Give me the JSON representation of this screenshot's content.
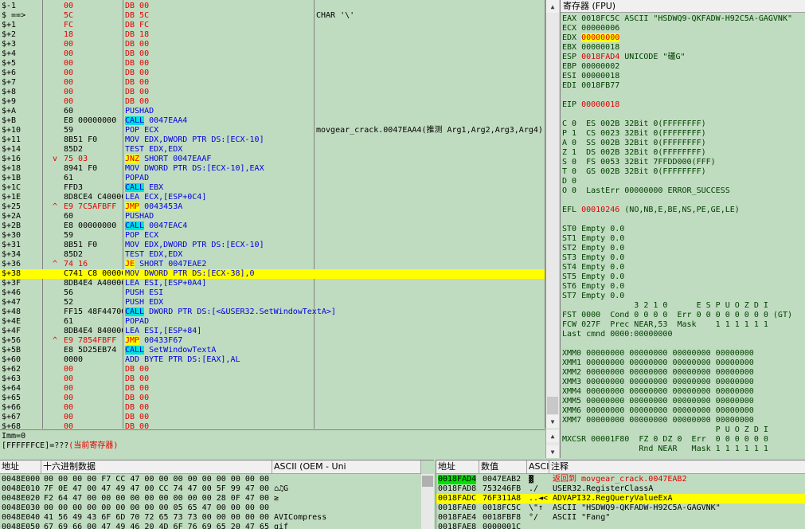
{
  "disasm": {
    "rows": [
      {
        "addr": "$-1",
        "hex": "00",
        "arrow": "",
        "instr": "DB 00",
        "instr_color": "red",
        "comment": ""
      },
      {
        "addr": "$ ==>",
        "hex": "5C",
        "arrow": "",
        "instr": "DB 5C",
        "instr_color": "red",
        "comment": "CHAR '\\'"
      },
      {
        "addr": "$+1",
        "hex": "FC",
        "arrow": "",
        "instr": "DB FC",
        "instr_color": "red",
        "comment": ""
      },
      {
        "addr": "$+2",
        "hex": "18",
        "arrow": "",
        "instr": "DB 18",
        "instr_color": "red",
        "comment": ""
      },
      {
        "addr": "$+3",
        "hex": "00",
        "arrow": "",
        "instr": "DB 00",
        "instr_color": "red",
        "comment": ""
      },
      {
        "addr": "$+4",
        "hex": "00",
        "arrow": "",
        "instr": "DB 00",
        "instr_color": "red",
        "comment": ""
      },
      {
        "addr": "$+5",
        "hex": "00",
        "arrow": "",
        "instr": "DB 00",
        "instr_color": "red",
        "comment": ""
      },
      {
        "addr": "$+6",
        "hex": "00",
        "arrow": "",
        "instr": "DB 00",
        "instr_color": "red",
        "comment": ""
      },
      {
        "addr": "$+7",
        "hex": "00",
        "arrow": "",
        "instr": "DB 00",
        "instr_color": "red",
        "comment": ""
      },
      {
        "addr": "$+8",
        "hex": "00",
        "arrow": "",
        "instr": "DB 00",
        "instr_color": "red",
        "comment": ""
      },
      {
        "addr": "$+9",
        "hex": "00",
        "arrow": "",
        "instr": "DB 00",
        "instr_color": "red",
        "comment": ""
      },
      {
        "addr": "$+A",
        "hex": "60",
        "arrow": "",
        "instr": "PUSHAD",
        "instr_color": "blue",
        "comment": ""
      },
      {
        "addr": "$+B",
        "hex": "E8 00000000",
        "arrow": "",
        "instr": "CALL 0047EAA4",
        "instr_color": "call",
        "comment": ""
      },
      {
        "addr": "$+10",
        "hex": "59",
        "arrow": "",
        "instr": "POP ECX",
        "instr_color": "blue",
        "comment": "movgear_crack.0047EAA4(推测 Arg1,Arg2,Arg3,Arg4)"
      },
      {
        "addr": "$+11",
        "hex": "8B51 F0",
        "arrow": "",
        "instr": "MOV EDX,DWORD PTR DS:[ECX-10]",
        "instr_color": "blue",
        "comment": ""
      },
      {
        "addr": "$+14",
        "hex": "85D2",
        "arrow": "",
        "instr": "TEST EDX,EDX",
        "instr_color": "blue",
        "comment": ""
      },
      {
        "addr": "$+16",
        "hex": "75 03",
        "arrow": "v",
        "instr": "JNZ SHORT 0047EAAF",
        "instr_color": "jmp",
        "comment": ""
      },
      {
        "addr": "$+18",
        "hex": "8941 F0",
        "arrow": "",
        "instr": "MOV DWORD PTR DS:[ECX-10],EAX",
        "instr_color": "blue",
        "comment": ""
      },
      {
        "addr": "$+1B",
        "hex": "61",
        "arrow": "",
        "instr": "POPAD",
        "instr_color": "blue",
        "comment": ""
      },
      {
        "addr": "$+1C",
        "hex": "FFD3",
        "arrow": "",
        "instr": "CALL EBX",
        "instr_color": "call",
        "comment": ""
      },
      {
        "addr": "$+1E",
        "hex": "8D8CE4 C40000",
        "arrow": "",
        "instr": "LEA ECX,[ESP+0C4]",
        "instr_color": "blue",
        "comment": ""
      },
      {
        "addr": "$+25",
        "hex": "E9 7C5AFBFF",
        "arrow": "^",
        "instr": "JMP 0043453A",
        "instr_color": "jmp",
        "comment": ""
      },
      {
        "addr": "$+2A",
        "hex": "60",
        "arrow": "",
        "instr": "PUSHAD",
        "instr_color": "blue",
        "comment": ""
      },
      {
        "addr": "$+2B",
        "hex": "E8 00000000",
        "arrow": "",
        "instr": "CALL 0047EAC4",
        "instr_color": "call",
        "comment": ""
      },
      {
        "addr": "$+30",
        "hex": "59",
        "arrow": "",
        "instr": "POP ECX",
        "instr_color": "blue",
        "comment": ""
      },
      {
        "addr": "$+31",
        "hex": "8B51 F0",
        "arrow": "",
        "instr": "MOV EDX,DWORD PTR DS:[ECX-10]",
        "instr_color": "blue",
        "comment": ""
      },
      {
        "addr": "$+34",
        "hex": "85D2",
        "arrow": "",
        "instr": "TEST EDX,EDX",
        "instr_color": "blue",
        "comment": ""
      },
      {
        "addr": "$+36",
        "hex": "74 16",
        "arrow": "^",
        "instr": "JE SHORT 0047EAE2",
        "instr_color": "jmp",
        "comment": ""
      },
      {
        "addr": "$+38",
        "hex": "C741 C8 00000000",
        "arrow": "",
        "instr": "MOV DWORD PTR DS:[ECX-38],0",
        "instr_color": "blue",
        "comment": "",
        "selected": true
      },
      {
        "addr": "$+3F",
        "hex": "8DB4E4 A40000",
        "arrow": "",
        "instr": "LEA ESI,[ESP+0A4]",
        "instr_color": "blue",
        "comment": ""
      },
      {
        "addr": "$+46",
        "hex": "56",
        "arrow": "",
        "instr": "PUSH ESI",
        "instr_color": "blue",
        "comment": ""
      },
      {
        "addr": "$+47",
        "hex": "52",
        "arrow": "",
        "instr": "PUSH EDX",
        "instr_color": "blue",
        "comment": ""
      },
      {
        "addr": "$+48",
        "hex": "FF15 48F44700",
        "arrow": "",
        "instr": "CALL DWORD PTR DS:[<&USER32.SetWindowTextA>]",
        "instr_color": "call",
        "comment": ""
      },
      {
        "addr": "$+4E",
        "hex": "61",
        "arrow": "",
        "instr": "POPAD",
        "instr_color": "blue",
        "comment": ""
      },
      {
        "addr": "$+4F",
        "hex": "8DB4E4 840000",
        "arrow": "",
        "instr": "LEA ESI,[ESP+84]",
        "instr_color": "blue",
        "comment": ""
      },
      {
        "addr": "$+56",
        "hex": "E9 7854FBFF",
        "arrow": "^",
        "instr": "JMP 00433F67",
        "instr_color": "jmp",
        "comment": ""
      },
      {
        "addr": "$+5B",
        "hex": "E8 5D25EB74",
        "arrow": "",
        "instr": "CALL SetWindowTextA",
        "instr_color": "call",
        "comment": ""
      },
      {
        "addr": "$+60",
        "hex": "0000",
        "arrow": "",
        "instr": "ADD BYTE PTR DS:[EAX],AL",
        "instr_color": "blue",
        "comment": ""
      },
      {
        "addr": "$+62",
        "hex": "00",
        "arrow": "",
        "instr": "DB 00",
        "instr_color": "red",
        "comment": ""
      },
      {
        "addr": "$+63",
        "hex": "00",
        "arrow": "",
        "instr": "DB 00",
        "instr_color": "red",
        "comment": ""
      },
      {
        "addr": "$+64",
        "hex": "00",
        "arrow": "",
        "instr": "DB 00",
        "instr_color": "red",
        "comment": ""
      },
      {
        "addr": "$+65",
        "hex": "00",
        "arrow": "",
        "instr": "DB 00",
        "instr_color": "red",
        "comment": ""
      },
      {
        "addr": "$+66",
        "hex": "00",
        "arrow": "",
        "instr": "DB 00",
        "instr_color": "red",
        "comment": ""
      },
      {
        "addr": "$+67",
        "hex": "00",
        "arrow": "",
        "instr": "DB 00",
        "instr_color": "red",
        "comment": ""
      },
      {
        "addr": "$+68",
        "hex": "00",
        "arrow": "",
        "instr": "DB 00",
        "instr_color": "red",
        "comment": ""
      }
    ]
  },
  "info": {
    "line1": "Imm=0",
    "line2_prefix": "[FFFFFFCE]=???",
    "line2_note": "(当前寄存器)"
  },
  "registers": {
    "title": "寄存器 (FPU)",
    "lines": [
      {
        "text": "EAX 0018FC5C ASCII \"HSDWQ9-QKFADW-H92C5A-GAGVNK\"",
        "red": false
      },
      {
        "text": "ECX 00000006",
        "red": false
      },
      {
        "text": "EDX 00000000",
        "red": true,
        "hl": "yellow"
      },
      {
        "text": "EBX 00000018",
        "red": false
      },
      {
        "text": "ESP 0018FAD4 UNICODE \"礚G\"",
        "red": true
      },
      {
        "text": "EBP 00000002",
        "red": false
      },
      {
        "text": "ESI 00000018",
        "red": false
      },
      {
        "text": "EDI 0018FB77",
        "red": false
      },
      {
        "text": "",
        "red": false
      },
      {
        "text": "EIP 00000018",
        "red": true
      },
      {
        "text": "",
        "red": false
      },
      {
        "text": "C 0  ES 002B 32Bit 0(FFFFFFFF)",
        "red": false
      },
      {
        "text": "P 1  CS 0023 32Bit 0(FFFFFFFF)",
        "red": false
      },
      {
        "text": "A 0  SS 002B 32Bit 0(FFFFFFFF)",
        "red": false
      },
      {
        "text": "Z 1  DS 002B 32Bit 0(FFFFFFFF)",
        "red": false
      },
      {
        "text": "S 0  FS 0053 32Bit 7FFDD000(FFF)",
        "red": false
      },
      {
        "text": "T 0  GS 002B 32Bit 0(FFFFFFFF)",
        "red": false
      },
      {
        "text": "D 0",
        "red": false
      },
      {
        "text": "O 0  LastErr 00000000 ERROR_SUCCESS",
        "red": false
      },
      {
        "text": "",
        "red": false
      },
      {
        "text": "EFL 00010246 (NO,NB,E,BE,NS,PE,GE,LE)",
        "red": true
      },
      {
        "text": "",
        "red": false
      },
      {
        "text": "ST0 Empty 0.0",
        "red": false
      },
      {
        "text": "ST1 Empty 0.0",
        "red": false
      },
      {
        "text": "ST2 Empty 0.0",
        "red": false
      },
      {
        "text": "ST3 Empty 0.0",
        "red": false
      },
      {
        "text": "ST4 Empty 0.0",
        "red": false
      },
      {
        "text": "ST5 Empty 0.0",
        "red": false
      },
      {
        "text": "ST6 Empty 0.0",
        "red": false
      },
      {
        "text": "ST7 Empty 0.0",
        "red": false
      },
      {
        "text": "               3 2 1 0      E S P U O Z D I",
        "red": false
      },
      {
        "text": "FST 0000  Cond 0 0 0 0  Err 0 0 0 0 0 0 0 0 (GT)",
        "red": false
      },
      {
        "text": "FCW 027F  Prec NEAR,53  Mask    1 1 1 1 1 1",
        "red": false
      },
      {
        "text": "Last cmnd 0000:00000000",
        "red": false
      },
      {
        "text": "",
        "red": false
      },
      {
        "text": "XMM0 00000000 00000000 00000000 00000000",
        "red": false
      },
      {
        "text": "XMM1 00000000 00000000 00000000 00000000",
        "red": false
      },
      {
        "text": "XMM2 00000000 00000000 00000000 00000000",
        "red": false
      },
      {
        "text": "XMM3 00000000 00000000 00000000 00000000",
        "red": false
      },
      {
        "text": "XMM4 00000000 00000000 00000000 00000000",
        "red": false
      },
      {
        "text": "XMM5 00000000 00000000 00000000 00000000",
        "red": false
      },
      {
        "text": "XMM6 00000000 00000000 00000000 00000000",
        "red": false
      },
      {
        "text": "XMM7 00000000 00000000 00000000 00000000",
        "red": false
      },
      {
        "text": "                                P U O Z D I",
        "red": false
      },
      {
        "text": "MXCSR 00001F80  FZ 0 DZ 0  Err  0 0 0 0 0 0",
        "red": false
      },
      {
        "text": "                Rnd NEAR   Mask 1 1 1 1 1 1",
        "red": false
      }
    ]
  },
  "dump": {
    "headers": {
      "addr": "地址",
      "hex": "十六进制数据",
      "ascii": "ASCII (OEM - Uni"
    },
    "rows": [
      {
        "addr": "0048E000",
        "hex": "00 00 00 00 F7 CC 47 00 00 00 00 00 00 00 00 00",
        "ascii": ""
      },
      {
        "addr": "0048E010",
        "hex": "7F 0E 47 00 47 49 47 00 CC 74 47 00 5F 99 47 00",
        "ascii": "⌂♫G"
      },
      {
        "addr": "0048E020",
        "hex": "F2 64 47 00 00 00 00 00 00 00 00 00 28 0F 47 00",
        "ascii": "≥"
      },
      {
        "addr": "0048E030",
        "hex": "00 00 00 00 00 00 00 00 00 05 65 47 00 00 00 00",
        "ascii": ""
      },
      {
        "addr": "0048E040",
        "hex": "41 56 49 43 6F 6D 70 72 65 73 73 00 00 00 00 00",
        "ascii": "AVICompress"
      },
      {
        "addr": "0048E050",
        "hex": "67 69 66 00 47 49 46 20 4D 6F 76 69 65 20 47 65",
        "ascii": "gif"
      }
    ]
  },
  "stack": {
    "headers": {
      "addr": "地址",
      "value": "数值",
      "ascii": "ASCI",
      "comment": "注释"
    },
    "rows": [
      {
        "addr": "0018FAD4",
        "value": "0047EAB2",
        "ascii": "▓",
        "comment": "返回到 movgear_crack.0047EAB2",
        "addr_hl": "green",
        "comment_red": true
      },
      {
        "addr": "0018FAD8",
        "value": "753246FB",
        "ascii": "./",
        "comment": "USER32.RegisterClassA"
      },
      {
        "addr": "0018FADC",
        "value": "76F311A8",
        "ascii": "..◄<",
        "comment": "ADVAPI32.RegQueryValueExA",
        "selected": true
      },
      {
        "addr": "0018FAE0",
        "value": "0018FC5C",
        "ascii": "\\\"↑",
        "comment": "ASCII \"HSDWQ9-QKFADW-H92C5A-GAGVNK\""
      },
      {
        "addr": "0018FAE4",
        "value": "0018FBF8",
        "ascii": "°/",
        "comment": "ASCII \"Fang\""
      },
      {
        "addr": "0018FAE8",
        "value": "0000001C",
        "ascii": "",
        "comment": ""
      }
    ]
  },
  "colors": {
    "background": "#c0dcc0",
    "red": "#e00000",
    "blue": "#0000e0",
    "call_highlight": "#00e0e0",
    "jmp_highlight": "#ffff00",
    "selection": "#ffff00"
  }
}
